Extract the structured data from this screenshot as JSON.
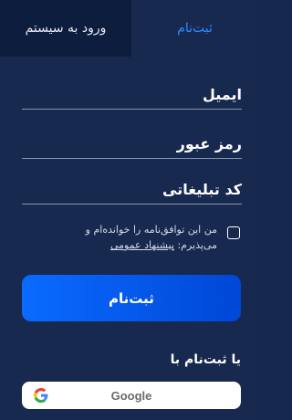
{
  "tabs": {
    "login_label": "ورود به سیستم",
    "register_label": "ثبت‌نام"
  },
  "form": {
    "email_placeholder": "ایمیل",
    "password_placeholder": "رمز عبور",
    "promo_placeholder": "کد تبلیغاتی",
    "terms_text": "من این توافق‌نامه را خوانده‌ام و می‌پذیرم:",
    "terms_link": "پیشنهاد عمومی",
    "submit_label": "ثبت‌نام"
  },
  "social": {
    "or_label": "یا ثبت‌نام با",
    "google_label": "Google"
  },
  "colors": {
    "background": "#17294f",
    "accent": "#2f8bff",
    "button_start": "#0a6bff",
    "button_end": "#0047d6"
  }
}
